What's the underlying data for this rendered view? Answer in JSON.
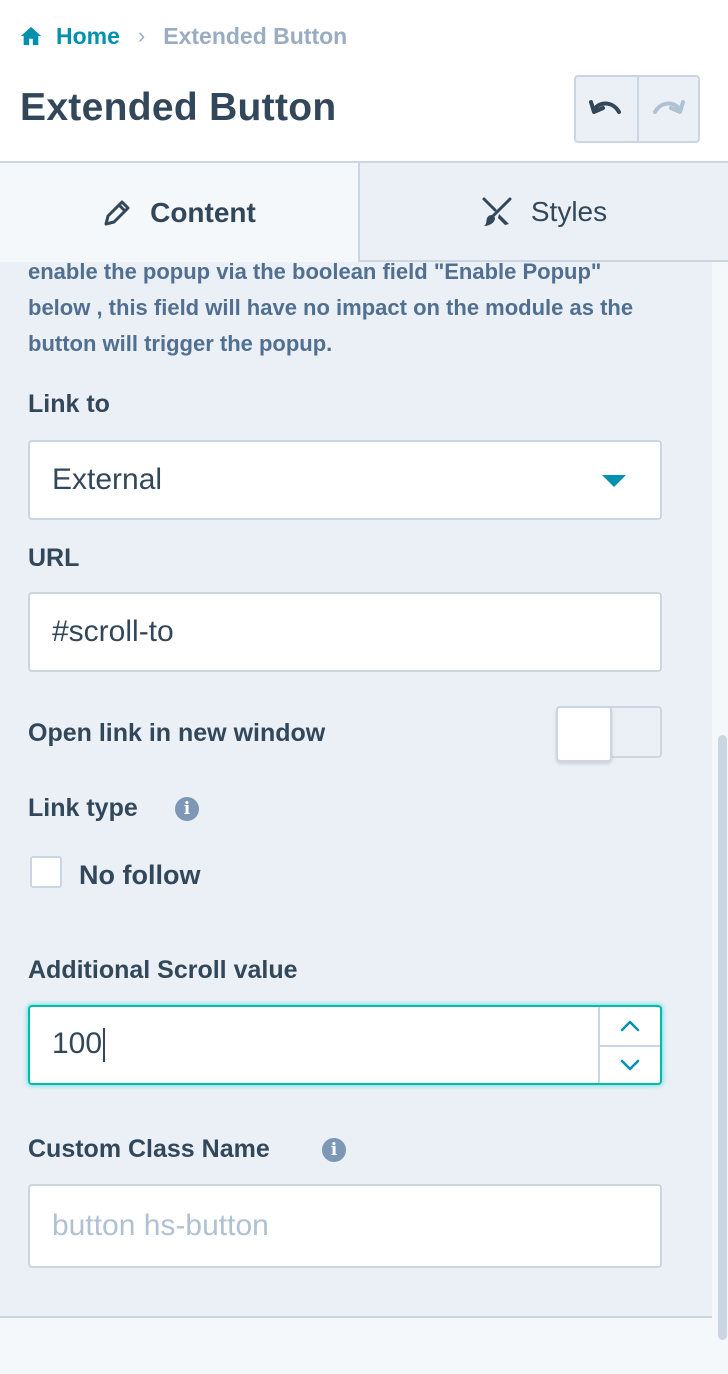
{
  "breadcrumb": {
    "home_label": "Home",
    "separator": "›",
    "current_label": "Extended Button"
  },
  "header": {
    "title": "Extended Button"
  },
  "tabs": [
    {
      "label": "Content",
      "icon": "pencil-icon",
      "active": true
    },
    {
      "label": "Styles",
      "icon": "paintbrush-icon",
      "active": false
    }
  ],
  "content": {
    "helper_text": "enable the popup via the boolean field \"Enable Popup\" below , this field will have no impact on the module as the button will trigger the popup.",
    "link_to": {
      "label": "Link to",
      "value": "External"
    },
    "url": {
      "label": "URL",
      "value": "#scroll-to"
    },
    "open_new_window": {
      "label": "Open link in new window",
      "enabled": false
    },
    "link_type": {
      "label": "Link type",
      "info_icon": "info-icon"
    },
    "no_follow": {
      "label": "No follow",
      "checked": false
    },
    "scroll_value": {
      "label": "Additional Scroll value",
      "value": "100"
    },
    "custom_class": {
      "label": "Custom Class Name",
      "value": "",
      "placeholder": "button hs-button"
    }
  },
  "colors": {
    "accent": "#0091ae",
    "text": "#33475b",
    "panel_bg": "#eaf0f6",
    "border": "#cbd6e2",
    "focus": "#00bda5"
  }
}
